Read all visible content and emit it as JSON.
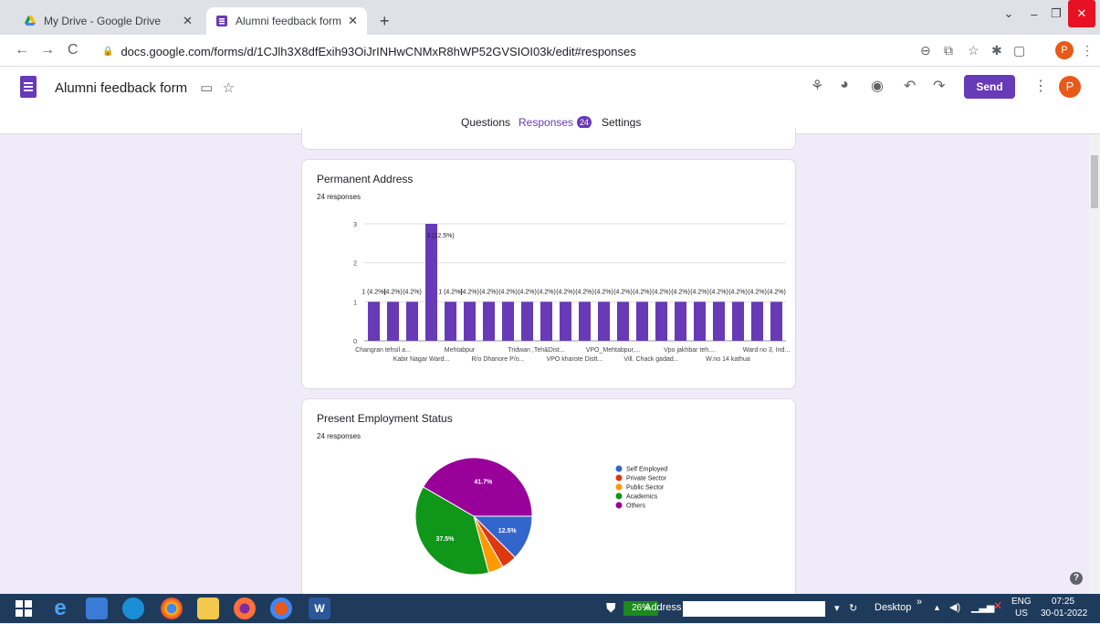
{
  "browser": {
    "tabs": [
      {
        "title": "My Drive - Google Drive",
        "icon": "google-drive-icon"
      },
      {
        "title": "Alumni feedback form - Google F",
        "icon": "google-forms-icon"
      }
    ],
    "url": "docs.google.com/forms/d/1CJlh3X8dfExih93OiJrINHwCNMxR8hWP52GVSIOI03k/edit#responses",
    "profile_initial": "P"
  },
  "forms": {
    "title": "Alumni feedback form",
    "send_label": "Send",
    "profile_initial": "P",
    "tabs": [
      {
        "label": "Questions"
      },
      {
        "label": "Responses",
        "badge": "24"
      },
      {
        "label": "Settings"
      }
    ]
  },
  "card_address": {
    "title": "Permanent Address",
    "count": "24 responses"
  },
  "card_employment": {
    "title": "Present Employment Status",
    "count": "24 responses"
  },
  "chart_data": [
    {
      "type": "bar",
      "title": "Permanent Address",
      "ylim": [
        0,
        3
      ],
      "yticks": [
        0,
        1,
        2,
        3
      ],
      "grid": true,
      "colors": [
        "#673ab7"
      ],
      "values": [
        1,
        1,
        1,
        3,
        1,
        1,
        1,
        1,
        1,
        1,
        1,
        1,
        1,
        1,
        1,
        1,
        1,
        1,
        1,
        1,
        1,
        1
      ],
      "data_labels": [
        "1 (4.2%)",
        "(4.2%)",
        "(4.2%)",
        "3 (12.5%)",
        "1 (4.2%)",
        "(4.2%)",
        "(4.2%)",
        "(4.2%)",
        "(4.2%)",
        "(4.2%)",
        "(4.2%)",
        "(4.2%)",
        "(4.2%)",
        "(4.2%)",
        "(4.2%)",
        "(4.2%)",
        "(4.2%)",
        "(4.2%)",
        "(4.2%)",
        "(4.2%)",
        "(4.2%)",
        "(4.2%)"
      ],
      "x_tick_labels_row1": [
        "Changran tehsil a...",
        "Mehtabpur",
        "Tridwan ,Teh&Dist...",
        "VPO_Mehtabpur,...",
        "Vpo jakhbar teh....",
        "Ward no 3, Ind..."
      ],
      "x_tick_labels_row2": [
        "Kabir Nagar Ward...",
        "R/o Dhanore P/o...",
        "VPO kharote Distt...",
        "Vill. Chack gadad...",
        "W.no 14 kathua"
      ]
    },
    {
      "type": "pie",
      "title": "Present Employment Status",
      "legend_position": "right",
      "slices": [
        {
          "label": "Self Employed",
          "value": 12.5,
          "color": "#3366cc",
          "pct_label": "12.5%"
        },
        {
          "label": "Private Sector",
          "value": 4.2,
          "color": "#dc3912",
          "pct_label": ""
        },
        {
          "label": "Public Sector",
          "value": 4.2,
          "color": "#ff9900",
          "pct_label": ""
        },
        {
          "label": "Academics",
          "value": 37.5,
          "color": "#109618",
          "pct_label": "37.5%"
        },
        {
          "label": "Others",
          "value": 41.7,
          "color": "#990099",
          "pct_label": "41.7%"
        }
      ]
    }
  ],
  "taskbar": {
    "battery": "26%",
    "address_label": "Address",
    "desktop_label": "Desktop",
    "lang": "ENG",
    "region": "US",
    "time": "07:25",
    "date": "30-01-2022"
  }
}
